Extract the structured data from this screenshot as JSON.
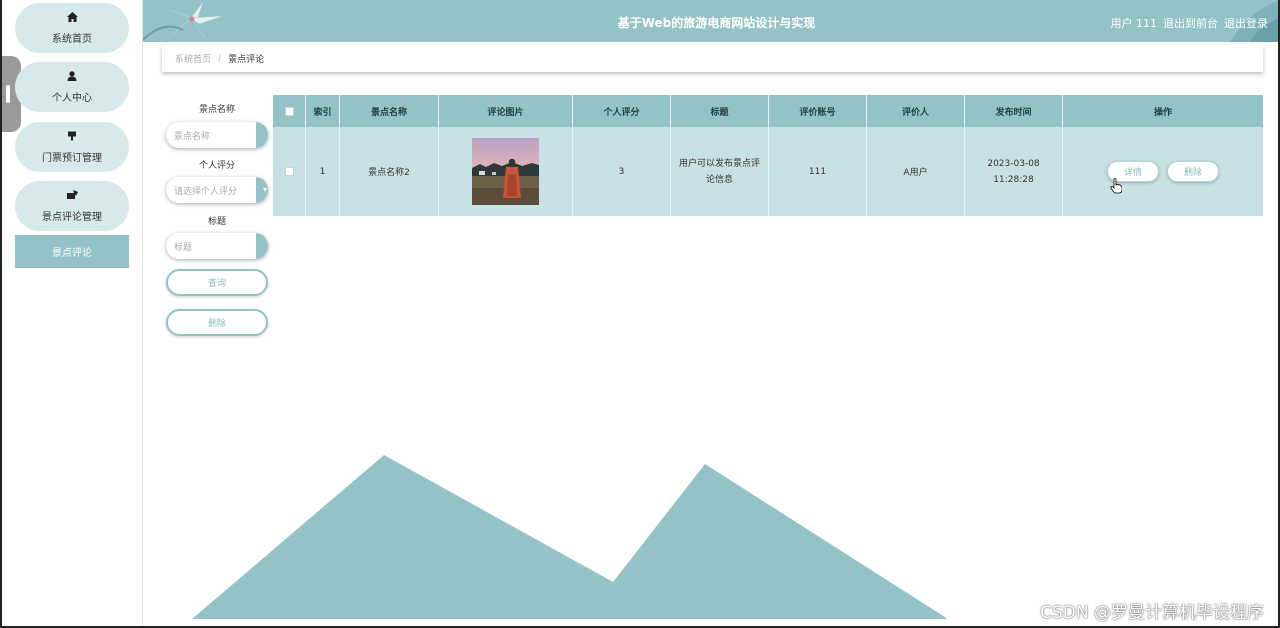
{
  "header": {
    "title": "基于Web的旅游电商网站设计与实现",
    "user": "用户 111",
    "back_to_front": "退出到前台",
    "logout": "退出登录"
  },
  "sidebar": {
    "items": [
      {
        "label": "系统首页",
        "icon": "home-icon"
      },
      {
        "label": "个人中心",
        "icon": "user-icon"
      },
      {
        "label": "门票预订管理",
        "icon": "ticket-icon"
      },
      {
        "label": "景点评论管理",
        "icon": "comment-icon"
      }
    ],
    "subitem": "景点评论"
  },
  "breadcrumb": {
    "home": "系统首页",
    "separator": "/",
    "current": "景点评论"
  },
  "search": {
    "spot_label": "景点名称",
    "spot_placeholder": "景点名称",
    "rating_label": "个人评分",
    "rating_placeholder": "请选择个人评分",
    "title_label": "标题",
    "title_placeholder": "标题",
    "query_button": "查询",
    "delete_button": "删除"
  },
  "table": {
    "headers": [
      "索引",
      "景点名称",
      "评论图片",
      "个人评分",
      "标题",
      "评价账号",
      "评价人",
      "发布时间",
      "操作"
    ],
    "rows": [
      {
        "index": "1",
        "spot": "景点名称2",
        "rating": "3",
        "title": "用户可以发布景点评论信息",
        "account": "111",
        "reviewer": "A用户",
        "time": "2023-03-08 11:28:28",
        "detail": "详情",
        "delete": "删除"
      }
    ]
  },
  "watermark": "CSDN @罗曼计算机毕设程序",
  "colors": {
    "accent": "#94c3c7",
    "menu_bg": "#d8e9ec",
    "row_bg": "#c8e1e4"
  }
}
